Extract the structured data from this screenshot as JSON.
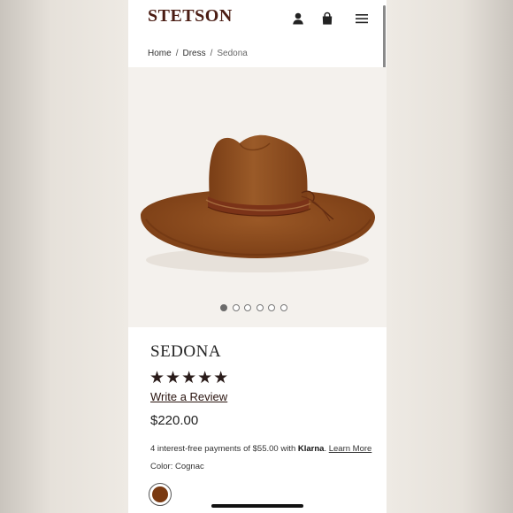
{
  "header": {
    "logo": "STETSON",
    "icons": [
      "user-icon",
      "bag-icon",
      "menu-icon"
    ]
  },
  "breadcrumb": {
    "items": [
      "Home",
      "Dress",
      "Sedona"
    ]
  },
  "gallery": {
    "image": "brown-wide-brim-hat",
    "dot_count": 6,
    "active_index": 0
  },
  "product": {
    "title": "SEDONA",
    "stars": "★★★★★",
    "rating": 5,
    "review_link": "Write a Review",
    "price": "$220.00",
    "klarna": {
      "prefix": "4 interest-free payments of $55.00 with",
      "brand": "Klarna",
      "suffix": ".",
      "learn_more": "Learn More"
    },
    "color_label": "Color:",
    "color_value": "Cognac",
    "swatch_color": "#7a3a12"
  },
  "colors": {
    "brand": "#4b1d14",
    "hat": "#8a4a1e",
    "background": "#f4f1ed"
  }
}
